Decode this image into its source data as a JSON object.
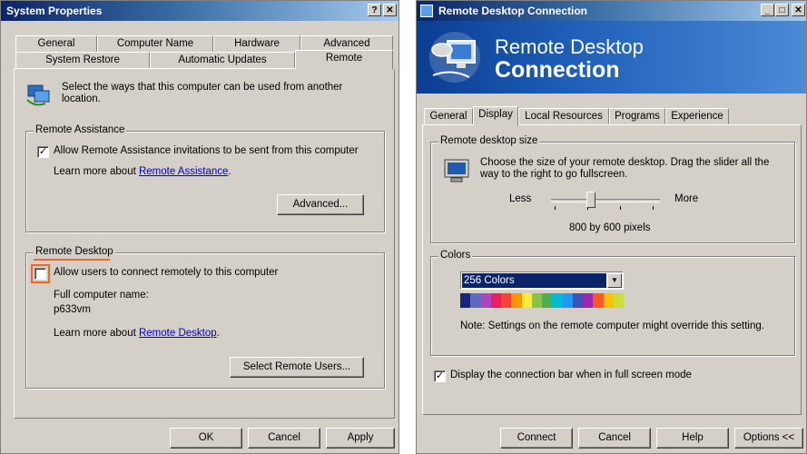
{
  "left": {
    "title": "System Properties",
    "help_btn": "?",
    "close_btn": "✕",
    "tabs_back": [
      "General",
      "Computer Name",
      "Hardware",
      "Advanced"
    ],
    "tabs_front": [
      "System Restore",
      "Automatic Updates",
      "Remote"
    ],
    "intro": "Select the ways that this computer can be used from another location.",
    "assist_group": "Remote Assistance",
    "assist_checkbox": "Allow Remote Assistance invitations to be sent from this computer",
    "assist_learn_prefix": "Learn more about ",
    "assist_learn_link": "Remote Assistance",
    "assist_learn_suffix": ".",
    "advanced_btn": "Advanced...",
    "desktop_group": "Remote Desktop",
    "desktop_checkbox": "Allow users to connect remotely to this computer",
    "fullname_label": "Full computer name:",
    "fullname_value": "p633vm",
    "desktop_learn_prefix": "Learn more about ",
    "desktop_learn_link": "Remote Desktop",
    "desktop_learn_suffix": ".",
    "select_users_btn": "Select Remote Users...",
    "ok_btn": "OK",
    "cancel_btn": "Cancel",
    "apply_btn": "Apply"
  },
  "right": {
    "title": "Remote Desktop Connection",
    "min_btn": "_",
    "max_btn": "□",
    "close_btn": "✕",
    "banner_line1": "Remote Desktop",
    "banner_line2": "Connection",
    "tabs": [
      "General",
      "Display",
      "Local Resources",
      "Programs",
      "Experience"
    ],
    "size_group": "Remote desktop size",
    "size_desc": "Choose the size of your remote desktop. Drag the slider all the way to the right to go fullscreen.",
    "less": "Less",
    "more": "More",
    "resolution": "800 by 600 pixels",
    "slider_level": 0.35,
    "colors_group": "Colors",
    "color_value": "256 Colors",
    "note": "Note: Settings on the remote computer might override this setting.",
    "connbar_checkbox": "Display the connection bar when in full screen mode",
    "connect_btn": "Connect",
    "cancel_btn": "Cancel",
    "help_btn": "Help",
    "options_btn": "Options <<"
  },
  "colors": {
    "highlight": "#f26522",
    "title_start": "#0a246a",
    "link": "#0000cc"
  }
}
